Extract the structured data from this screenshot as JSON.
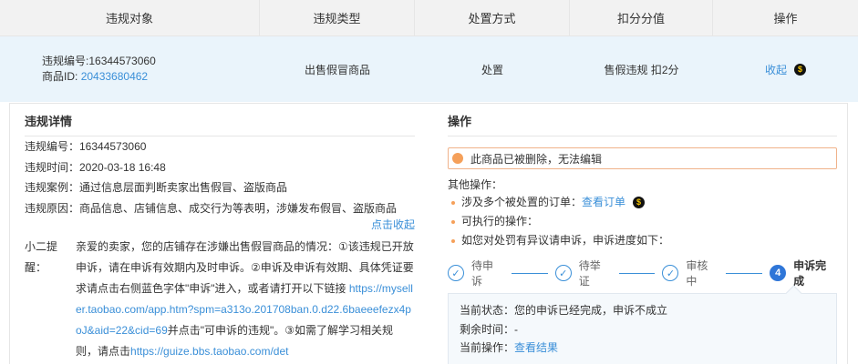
{
  "table": {
    "headers": [
      "违规对象",
      "违规类型",
      "处置方式",
      "扣分分值",
      "操作"
    ],
    "row": {
      "violation_no_label": "违规编号:",
      "violation_no": "16344573060",
      "product_id_label": "商品ID:",
      "product_id": "20433680462",
      "type": "出售假冒商品",
      "action": "处置",
      "score": "售假违规 扣2分",
      "op_link": "收起",
      "coin_icon": "dollar-coin-icon"
    }
  },
  "details": {
    "title": "违规详情",
    "items": [
      "违规编号：16344573060",
      "违规时间：2020-03-18 16:48",
      "违规案例：通过信息层面判断卖家出售假冒、盗版商品",
      "违规原因：商品信息、店铺信息、成交行为等表明，涉嫌发布假冒、盗版商品"
    ],
    "collapse_link": "点击收起",
    "tip_label": "小二提醒：",
    "tip_p1": "亲爱的卖家，您的店铺存在涉嫌出售假冒商品的情况：①该违规已开放申诉，请在申诉有效期内及时申诉。②申诉及申诉有效期、具体凭证要求请点击右侧蓝色字体\"申诉\"进入，或者请打开以下链接",
    "tip_link1": "https://myseller.taobao.com/app.htm?spm=a313o.201708ban.0.d22.6baeeefezx4poJ&aid=22&cid=69",
    "tip_p2": "并点击\"可申诉的违规\"。③如需了解学习相关规则，请点击",
    "tip_link2": "https://guize.bbs.taobao.com/det"
  },
  "ops": {
    "title": "操作",
    "warning": "此商品已被删除，无法编辑",
    "other_label": "其他操作：",
    "bullets": {
      "b1_text": "涉及多个被处置的订单：",
      "b1_link": "查看订单",
      "b2_text": "可执行的操作：",
      "b3_text": "如您对处罚有异议请申诉，申诉进度如下："
    },
    "steps": [
      {
        "label": "待申诉",
        "mark": "✓"
      },
      {
        "label": "待举证",
        "mark": "✓"
      },
      {
        "label": "审核中",
        "mark": "✓"
      },
      {
        "label": "申诉完成",
        "mark": "4"
      }
    ],
    "status": {
      "current_status": "当前状态：您的申诉已经完成，申诉不成立",
      "remaining": "剩余时间：-",
      "current_op_label": "当前操作：",
      "current_op_link": "查看结果"
    }
  }
}
